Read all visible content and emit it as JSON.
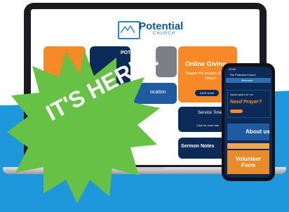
{
  "logo": {
    "name": "Potential",
    "sub": "CHURCH"
  },
  "laptop_tiles": {
    "giving_title": "Online Giving",
    "giving_sub": "Support the mission of Potential Church",
    "giving_btn": "GIVE NOW",
    "podcast": "POTENTIAL",
    "location": "ocation",
    "service_title": "Service Times",
    "service_sub": "Click for more info",
    "sermon": "Sermon Notes"
  },
  "phone": {
    "status": "12:00",
    "title": "The Potential Church",
    "welcome": "Welcome",
    "prayer_small": "WE'RE HERE FOR YOU",
    "prayer": "Need Prayer?",
    "about": "About us",
    "volunteer": "Volunteer Form"
  },
  "burst": {
    "text": "IT'S HERE!!"
  },
  "colors": {
    "accent_blue": "#1e97dd",
    "navy": "#0c2a57",
    "orange": "#f58a26",
    "burst_green": "#66c144"
  }
}
